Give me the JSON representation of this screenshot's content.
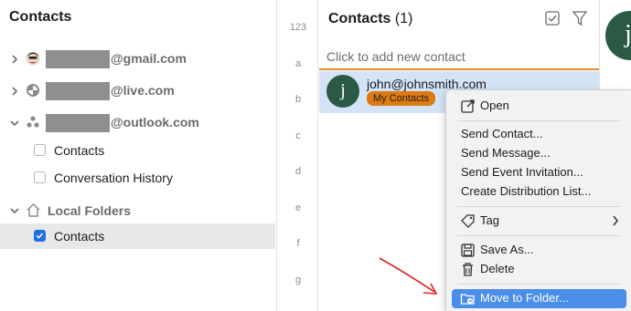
{
  "sidebar": {
    "title": "Contacts",
    "accounts": [
      {
        "suffix": "@gmail.com",
        "icon": "user-photo-icon"
      },
      {
        "suffix": "@live.com",
        "icon": "outlook-live-icon"
      },
      {
        "suffix": "@outlook.com",
        "icon": "people-icon"
      }
    ],
    "folders": [
      {
        "label": "Contacts",
        "checked": false
      },
      {
        "label": "Conversation History",
        "checked": false
      }
    ],
    "local": {
      "label": "Local Folders",
      "folder": {
        "label": "Contacts",
        "checked": true
      }
    }
  },
  "alphabet": [
    "123",
    "a",
    "b",
    "c",
    "d",
    "e",
    "f",
    "g"
  ],
  "list": {
    "title": "Contacts",
    "count": "(1)",
    "add_placeholder": "Click to add new contact",
    "contacts": [
      {
        "initial": "j",
        "email": "john@johnsmith.com",
        "tag": "My Contacts"
      }
    ]
  },
  "detail": {
    "initial": "j"
  },
  "context_menu": {
    "open": "Open",
    "send_contact": "Send Contact...",
    "send_message": "Send Message...",
    "send_event": "Send Event Invitation...",
    "create_list": "Create Distribution List...",
    "tag": "Tag",
    "save_as": "Save As...",
    "delete": "Delete",
    "move_to_folder": "Move to Folder..."
  },
  "colors": {
    "accent": "#4a8ee8",
    "tag_orange": "#dd7b12",
    "avatar_green": "#2a5a44",
    "selection_blue": "#d4e3f7",
    "annotation_red": "#e02020"
  }
}
